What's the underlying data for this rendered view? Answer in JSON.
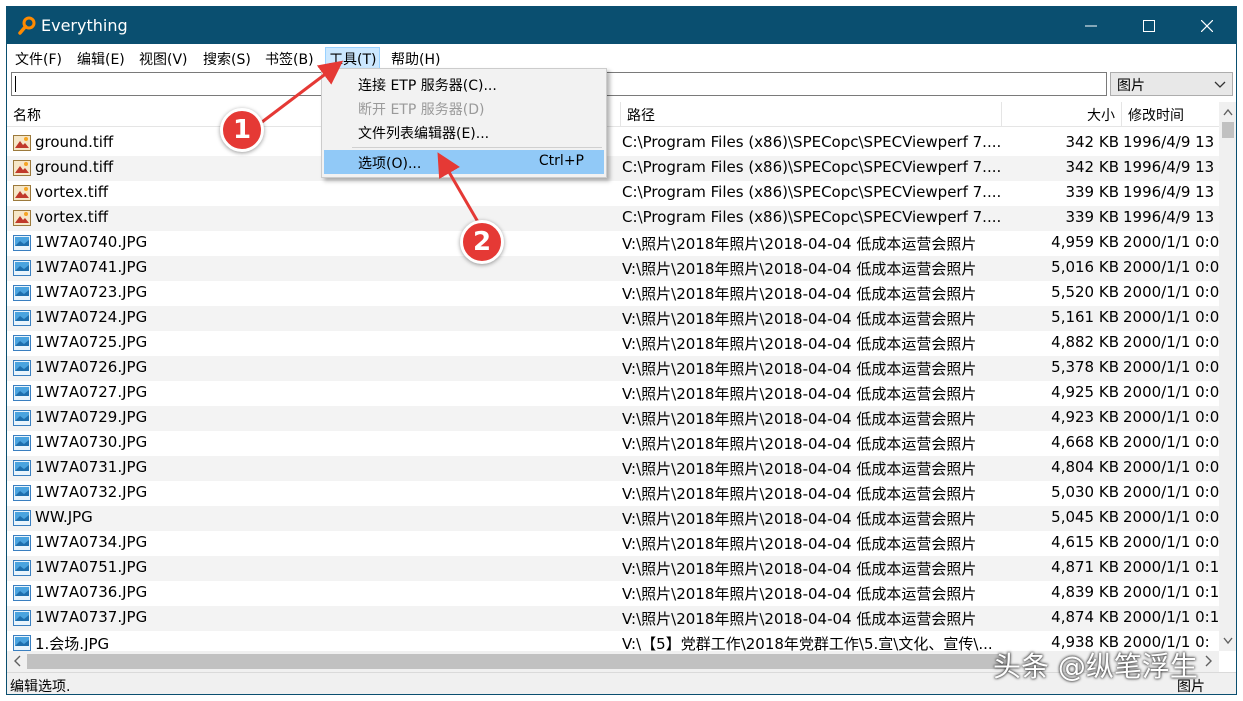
{
  "window": {
    "title": "Everything",
    "title_color": "#0a4f70"
  },
  "menubar": {
    "items": [
      {
        "label": "文件(F)"
      },
      {
        "label": "编辑(E)"
      },
      {
        "label": "视图(V)"
      },
      {
        "label": "搜索(S)"
      },
      {
        "label": "书签(B)"
      },
      {
        "label": "工具(T)",
        "active": true
      },
      {
        "label": "帮助(H)"
      }
    ]
  },
  "search": {
    "value": "",
    "filter": "图片"
  },
  "columns": {
    "name": "名称",
    "path": "路径",
    "size": "大小",
    "modified": "修改时间"
  },
  "dropdown": {
    "items": [
      {
        "label": "连接 ETP 服务器(C)...",
        "shortcut": "",
        "state": "normal"
      },
      {
        "label": "断开 ETP 服务器(D)",
        "shortcut": "",
        "state": "disabled"
      },
      {
        "label": "文件列表编辑器(E)...",
        "shortcut": "",
        "state": "normal"
      },
      {
        "label": "选项(O)...",
        "shortcut": "Ctrl+P",
        "state": "hover"
      }
    ]
  },
  "rows": [
    {
      "icon": "tiff-image-icon",
      "name": "ground.tiff",
      "path": "C:\\Program Files (x86)\\SPECopc\\SPECViewperf 7....",
      "size": "342 KB",
      "modified": "1996/4/9 13"
    },
    {
      "icon": "tiff-image-icon",
      "name": "ground.tiff",
      "path": "C:\\Program Files (x86)\\SPECopc\\SPECViewperf 7....",
      "size": "342 KB",
      "modified": "1996/4/9 13"
    },
    {
      "icon": "tiff-image-icon",
      "name": "vortex.tiff",
      "path": "C:\\Program Files (x86)\\SPECopc\\SPECViewperf 7....",
      "size": "339 KB",
      "modified": "1996/4/9 13"
    },
    {
      "icon": "tiff-image-icon",
      "name": "vortex.tiff",
      "path": "C:\\Program Files (x86)\\SPECopc\\SPECViewperf 7....",
      "size": "339 KB",
      "modified": "1996/4/9 13"
    },
    {
      "icon": "jpg-image-icon",
      "name": "1W7A0740.JPG",
      "path": "V:\\照片\\2018年照片\\2018-04-04 低成本运营会照片",
      "size": "4,959 KB",
      "modified": "2000/1/1 0:0"
    },
    {
      "icon": "jpg-image-icon",
      "name": "1W7A0741.JPG",
      "path": "V:\\照片\\2018年照片\\2018-04-04 低成本运营会照片",
      "size": "5,016 KB",
      "modified": "2000/1/1 0:0"
    },
    {
      "icon": "jpg-image-icon",
      "name": "1W7A0723.JPG",
      "path": "V:\\照片\\2018年照片\\2018-04-04 低成本运营会照片",
      "size": "5,520 KB",
      "modified": "2000/1/1 0:0"
    },
    {
      "icon": "jpg-image-icon",
      "name": "1W7A0724.JPG",
      "path": "V:\\照片\\2018年照片\\2018-04-04 低成本运营会照片",
      "size": "5,161 KB",
      "modified": "2000/1/1 0:0"
    },
    {
      "icon": "jpg-image-icon",
      "name": "1W7A0725.JPG",
      "path": "V:\\照片\\2018年照片\\2018-04-04 低成本运营会照片",
      "size": "4,882 KB",
      "modified": "2000/1/1 0:0"
    },
    {
      "icon": "jpg-image-icon",
      "name": "1W7A0726.JPG",
      "path": "V:\\照片\\2018年照片\\2018-04-04 低成本运营会照片",
      "size": "5,378 KB",
      "modified": "2000/1/1 0:0"
    },
    {
      "icon": "jpg-image-icon",
      "name": "1W7A0727.JPG",
      "path": "V:\\照片\\2018年照片\\2018-04-04 低成本运营会照片",
      "size": "4,925 KB",
      "modified": "2000/1/1 0:0"
    },
    {
      "icon": "jpg-image-icon",
      "name": "1W7A0729.JPG",
      "path": "V:\\照片\\2018年照片\\2018-04-04 低成本运营会照片",
      "size": "4,923 KB",
      "modified": "2000/1/1 0:0"
    },
    {
      "icon": "jpg-image-icon",
      "name": "1W7A0730.JPG",
      "path": "V:\\照片\\2018年照片\\2018-04-04 低成本运营会照片",
      "size": "4,668 KB",
      "modified": "2000/1/1 0:0"
    },
    {
      "icon": "jpg-image-icon",
      "name": "1W7A0731.JPG",
      "path": "V:\\照片\\2018年照片\\2018-04-04 低成本运营会照片",
      "size": "4,804 KB",
      "modified": "2000/1/1 0:0"
    },
    {
      "icon": "jpg-image-icon",
      "name": "1W7A0732.JPG",
      "path": "V:\\照片\\2018年照片\\2018-04-04 低成本运营会照片",
      "size": "5,030 KB",
      "modified": "2000/1/1 0:0"
    },
    {
      "icon": "jpg-image-icon",
      "name": "WW.JPG",
      "path": "V:\\照片\\2018年照片\\2018-04-04 低成本运营会照片",
      "size": "5,045 KB",
      "modified": "2000/1/1 0:0"
    },
    {
      "icon": "jpg-image-icon",
      "name": "1W7A0734.JPG",
      "path": "V:\\照片\\2018年照片\\2018-04-04 低成本运营会照片",
      "size": "4,615 KB",
      "modified": "2000/1/1 0:0"
    },
    {
      "icon": "jpg-image-icon",
      "name": "1W7A0751.JPG",
      "path": "V:\\照片\\2018年照片\\2018-04-04 低成本运营会照片",
      "size": "4,871 KB",
      "modified": "2000/1/1 0:1"
    },
    {
      "icon": "jpg-image-icon",
      "name": "1W7A0736.JPG",
      "path": "V:\\照片\\2018年照片\\2018-04-04 低成本运营会照片",
      "size": "4,839 KB",
      "modified": "2000/1/1 0:1"
    },
    {
      "icon": "jpg-image-icon",
      "name": "1W7A0737.JPG",
      "path": "V:\\照片\\2018年照片\\2018-04-04 低成本运营会照片",
      "size": "4,874 KB",
      "modified": "2000/1/1 0:1"
    },
    {
      "icon": "jpg-image-icon",
      "name": "1.会场.JPG",
      "path": "V:\\【5】党群工作\\2018年党群工作\\5.宣\\文化、宣传\\...",
      "size": "4,938 KB",
      "modified": "2000/1/1 0:"
    }
  ],
  "status": {
    "text": "编辑选项.",
    "right": "图片"
  },
  "annotations": {
    "badge1": "1",
    "badge2": "2",
    "arrow_color": "#e53935",
    "watermark": "头条 @纵笔浮生"
  }
}
